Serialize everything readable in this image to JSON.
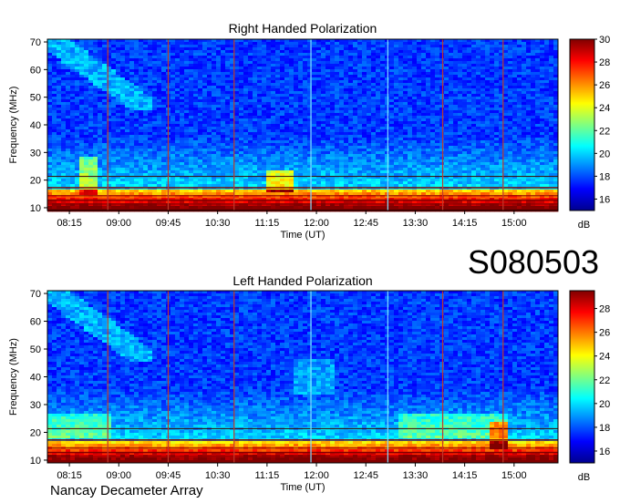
{
  "station_id": "S080503",
  "footer": "Nancay Decameter Array",
  "colors": {
    "colormap": [
      "#00008f",
      "#0000ff",
      "#0080ff",
      "#00ffff",
      "#80ff80",
      "#ffff00",
      "#ff8000",
      "#ff0000",
      "#800000"
    ],
    "marker_red": "#c0392b",
    "marker_cyan": "#7fe0ff"
  },
  "chart_data": [
    {
      "type": "heatmap",
      "title": "Right Handed Polarization",
      "xlabel": "Time (UT)",
      "ylabel": "Frequency (MHz)",
      "x_ticks": [
        "08:15",
        "09:00",
        "09:45",
        "10:30",
        "11:15",
        "12:00",
        "12:45",
        "13:30",
        "14:15",
        "15:00"
      ],
      "y_ticks": [
        10,
        20,
        30,
        40,
        50,
        60,
        70
      ],
      "ylim": [
        9,
        71
      ],
      "colorbar": {
        "label": "dB",
        "ticks": [
          16,
          18,
          20,
          22,
          24,
          26,
          28,
          30
        ],
        "range": [
          15,
          30
        ]
      },
      "markers": [
        {
          "time": "08:50",
          "color": "red"
        },
        {
          "time": "09:45",
          "color": "red"
        },
        {
          "time": "10:45",
          "color": "red"
        },
        {
          "time": "11:55",
          "color": "cyan"
        },
        {
          "time": "13:05",
          "color": "cyan"
        },
        {
          "time": "13:55",
          "color": "red"
        },
        {
          "time": "14:50",
          "color": "red"
        }
      ]
    },
    {
      "type": "heatmap",
      "title": "Left Handed Polarization",
      "xlabel": "Time (UT)",
      "ylabel": "Frequency (MHz)",
      "x_ticks": [
        "08:15",
        "09:00",
        "09:45",
        "10:30",
        "11:15",
        "12:00",
        "12:45",
        "13:30",
        "14:15",
        "15:00"
      ],
      "y_ticks": [
        10,
        20,
        30,
        40,
        50,
        60,
        70
      ],
      "ylim": [
        9,
        71
      ],
      "colorbar": {
        "label": "dB",
        "ticks": [
          16,
          18,
          20,
          22,
          24,
          26,
          28
        ],
        "range": [
          15,
          29.5
        ]
      },
      "markers": [
        {
          "time": "08:50",
          "color": "red"
        },
        {
          "time": "09:45",
          "color": "red"
        },
        {
          "time": "10:45",
          "color": "red"
        },
        {
          "time": "11:55",
          "color": "cyan"
        },
        {
          "time": "13:05",
          "color": "cyan"
        },
        {
          "time": "13:55",
          "color": "red"
        },
        {
          "time": "14:50",
          "color": "red"
        }
      ]
    }
  ]
}
